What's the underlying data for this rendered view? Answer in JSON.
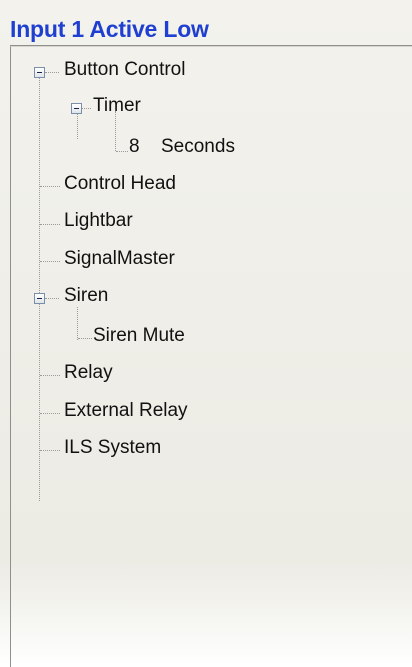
{
  "title": "Input 1 Active Low",
  "tree": {
    "button_control": "Button Control",
    "timer": "Timer",
    "timer_value": "8",
    "timer_unit": "Seconds",
    "control_head": "Control Head",
    "lightbar": "Lightbar",
    "signalmaster": "SignalMaster",
    "siren": "Siren",
    "siren_mute": "Siren Mute",
    "relay": "Relay",
    "external_relay": "External Relay",
    "ils_system": "ILS System"
  },
  "colors": {
    "title": "#1f3fd0",
    "text": "#111111",
    "panel_background": "#eceae3"
  },
  "icons": {
    "expander": "minus-box-icon"
  }
}
